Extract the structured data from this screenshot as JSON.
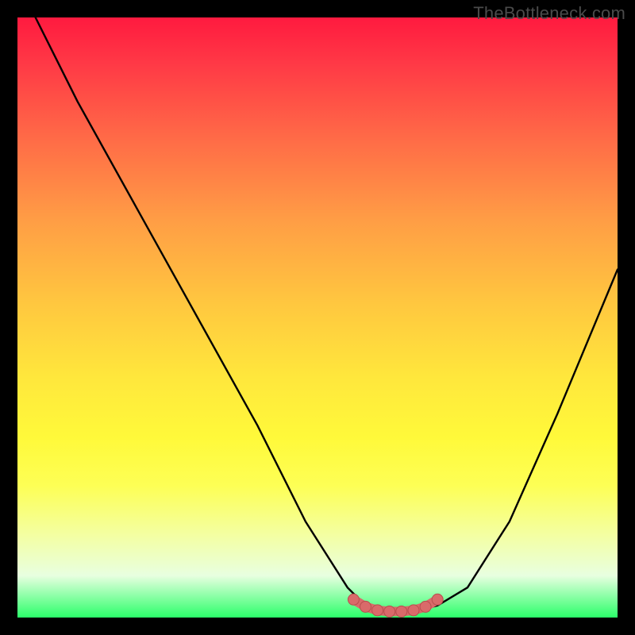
{
  "watermark": "TheBottleneck.com",
  "colors": {
    "background": "#000000",
    "curve_stroke": "#000000",
    "marker_fill": "#d96a6a",
    "marker_stroke": "#b84e4e"
  },
  "chart_data": {
    "type": "line",
    "title": "",
    "xlabel": "",
    "ylabel": "",
    "xlim": [
      0,
      100
    ],
    "ylim": [
      0,
      100
    ],
    "series": [
      {
        "name": "bottleneck-curve",
        "x": [
          3,
          10,
          20,
          30,
          40,
          48,
          55,
          58,
          62,
          66,
          70,
          75,
          82,
          90,
          100
        ],
        "y": [
          100,
          86,
          68,
          50,
          32,
          16,
          5,
          2,
          1,
          1,
          2,
          5,
          16,
          34,
          58
        ]
      }
    ],
    "markers": {
      "name": "optimal-range",
      "x": [
        56,
        58,
        60,
        62,
        64,
        66,
        68,
        70
      ],
      "y": [
        3.0,
        1.8,
        1.2,
        1.0,
        1.0,
        1.2,
        1.8,
        3.0
      ]
    }
  }
}
